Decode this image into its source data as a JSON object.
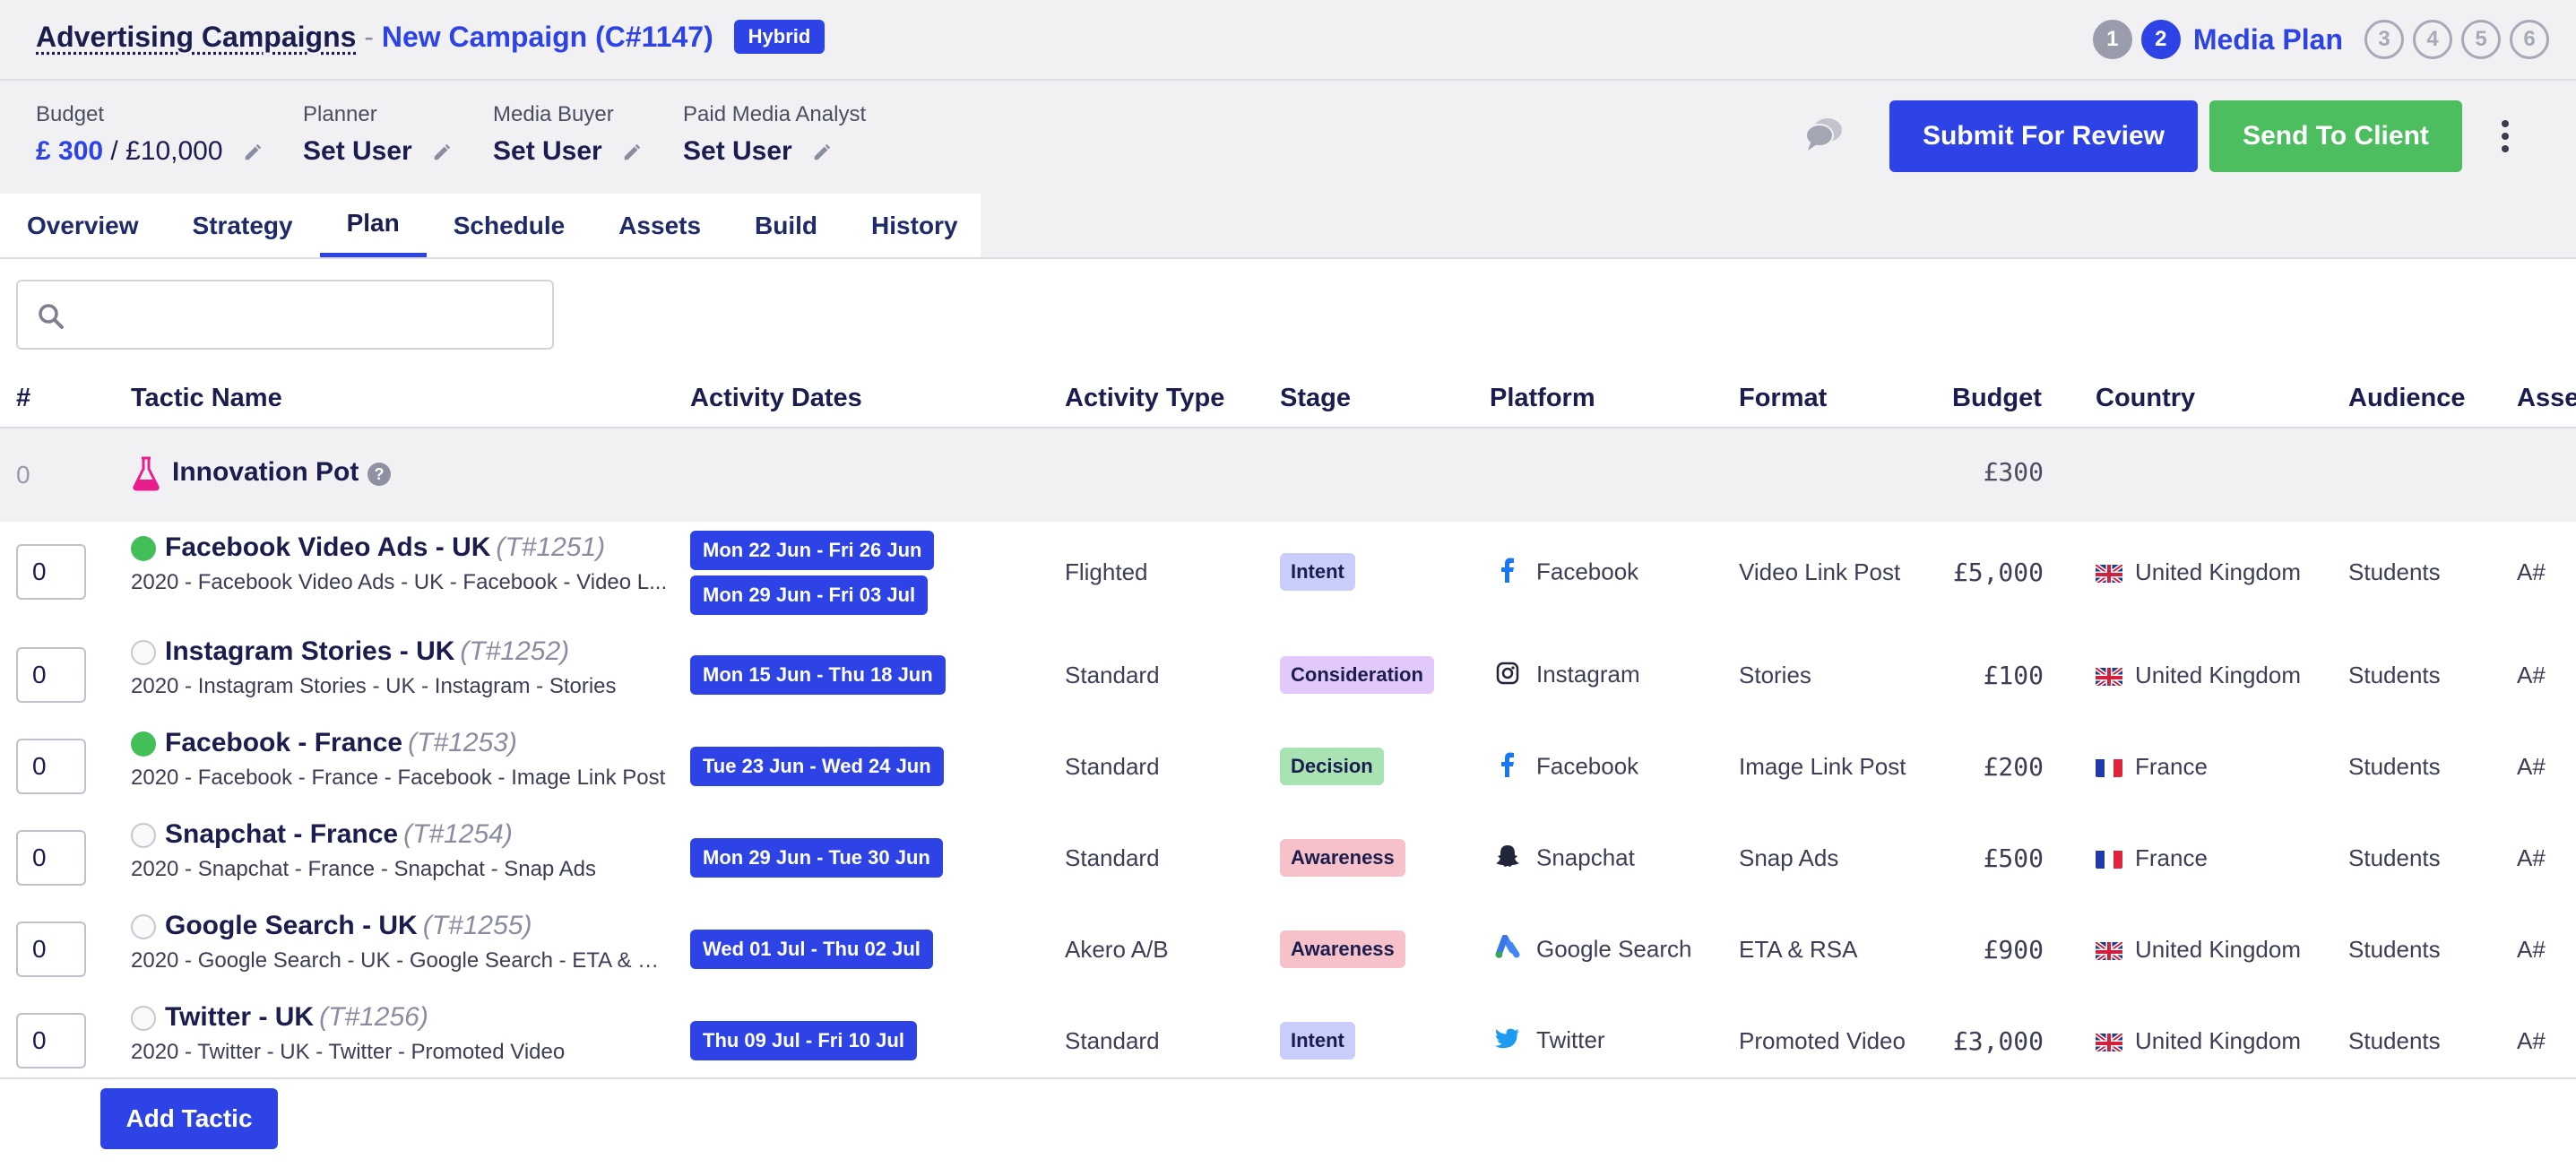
{
  "header": {
    "breadcrumb_root": "Advertising Campaigns",
    "separator": " - ",
    "campaign_name": "New Campaign (C#1147)",
    "badge": "Hybrid"
  },
  "stepper": {
    "steps": [
      "1",
      "2",
      "3",
      "4",
      "5",
      "6"
    ],
    "current_step": 2,
    "current_label": "Media Plan"
  },
  "meta": {
    "budget_label": "Budget",
    "budget_used": "£ 300",
    "budget_total": " / £10,000",
    "planner_label": "Planner",
    "planner_value": "Set User",
    "media_buyer_label": "Media Buyer",
    "media_buyer_value": "Set User",
    "analyst_label": "Paid Media Analyst",
    "analyst_value": "Set User"
  },
  "actions": {
    "submit_label": "Submit For Review",
    "send_label": "Send To Client"
  },
  "tabs": [
    "Overview",
    "Strategy",
    "Plan",
    "Schedule",
    "Assets",
    "Build",
    "History"
  ],
  "active_tab": "Plan",
  "search": {
    "placeholder": "",
    "value": ""
  },
  "columns": [
    "#",
    "Tactic Name",
    "Activity Dates",
    "Activity Type",
    "Stage",
    "Platform",
    "Format",
    "Budget",
    "Country",
    "Audience",
    "Asse"
  ],
  "group": {
    "number": "0",
    "name": "Innovation Pot",
    "help": "?",
    "budget": "£300"
  },
  "rows": [
    {
      "qty": "0",
      "status": "active",
      "name": "Facebook Video Ads - UK",
      "id": "(T#1251)",
      "subtitle": "2020 - Facebook Video Ads - UK - Facebook - Video L...",
      "dates": [
        "Mon 22 Jun - Fri 26 Jun",
        "Mon 29 Jun - Fri 03 Jul"
      ],
      "type": "Flighted",
      "stage": "Intent",
      "platform": "Facebook",
      "platform_icon": "facebook-icon",
      "format": "Video Link Post",
      "budget": "£5,000",
      "country": "United Kingdom",
      "flag": "uk-flag",
      "audience": "Students",
      "asset": "A#"
    },
    {
      "qty": "0",
      "status": "inactive",
      "name": "Instagram Stories - UK",
      "id": "(T#1252)",
      "subtitle": "2020 - Instagram Stories - UK - Instagram - Stories",
      "dates": [
        "Mon 15 Jun - Thu 18 Jun"
      ],
      "type": "Standard",
      "stage": "Consideration",
      "platform": "Instagram",
      "platform_icon": "instagram-icon",
      "format": "Stories",
      "budget": "£100",
      "country": "United Kingdom",
      "flag": "uk-flag",
      "audience": "Students",
      "asset": "A#"
    },
    {
      "qty": "0",
      "status": "active",
      "name": "Facebook - France",
      "id": "(T#1253)",
      "subtitle": "2020 - Facebook - France - Facebook - Image Link Post",
      "dates": [
        "Tue 23 Jun - Wed 24 Jun"
      ],
      "type": "Standard",
      "stage": "Decision",
      "platform": "Facebook",
      "platform_icon": "facebook-icon",
      "format": "Image Link Post",
      "budget": "£200",
      "country": "France",
      "flag": "france-flag",
      "audience": "Students",
      "asset": "A#"
    },
    {
      "qty": "0",
      "status": "inactive",
      "name": "Snapchat - France",
      "id": "(T#1254)",
      "subtitle": "2020 - Snapchat - France - Snapchat - Snap Ads",
      "dates": [
        "Mon 29 Jun - Tue 30 Jun"
      ],
      "type": "Standard",
      "stage": "Awareness",
      "platform": "Snapchat",
      "platform_icon": "snapchat-icon",
      "format": "Snap Ads",
      "budget": "£500",
      "country": "France",
      "flag": "france-flag",
      "audience": "Students",
      "asset": "A#"
    },
    {
      "qty": "0",
      "status": "inactive",
      "name": "Google Search - UK",
      "id": "(T#1255)",
      "subtitle": "2020 - Google Search - UK - Google Search - ETA & R...",
      "dates": [
        "Wed 01 Jul - Thu 02 Jul"
      ],
      "type": "Akero A/B",
      "stage": "Awareness",
      "platform": "Google Search",
      "platform_icon": "google-ads-icon",
      "format": "ETA & RSA",
      "budget": "£900",
      "country": "United Kingdom",
      "flag": "uk-flag",
      "audience": "Students",
      "asset": "A#"
    },
    {
      "qty": "0",
      "status": "inactive",
      "name": "Twitter - UK",
      "id": "(T#1256)",
      "subtitle": "2020 - Twitter - UK - Twitter - Promoted Video",
      "dates": [
        "Thu 09 Jul - Fri 10 Jul"
      ],
      "type": "Standard",
      "stage": "Intent",
      "platform": "Twitter",
      "platform_icon": "twitter-icon",
      "format": "Promoted Video",
      "budget": "£3,000",
      "country": "United Kingdom",
      "flag": "uk-flag",
      "audience": "Students",
      "asset": "A#"
    }
  ],
  "stage_colors": {
    "Intent": "#c9cdfb",
    "Consideration": "#e2c9fb",
    "Decision": "#a9e3b4",
    "Awareness": "#f6c1c8"
  },
  "colors": {
    "primary": "#2d43e6",
    "success": "#4cbe60",
    "flask": "#e91e8c"
  },
  "add_button_label": "Add Tactic"
}
